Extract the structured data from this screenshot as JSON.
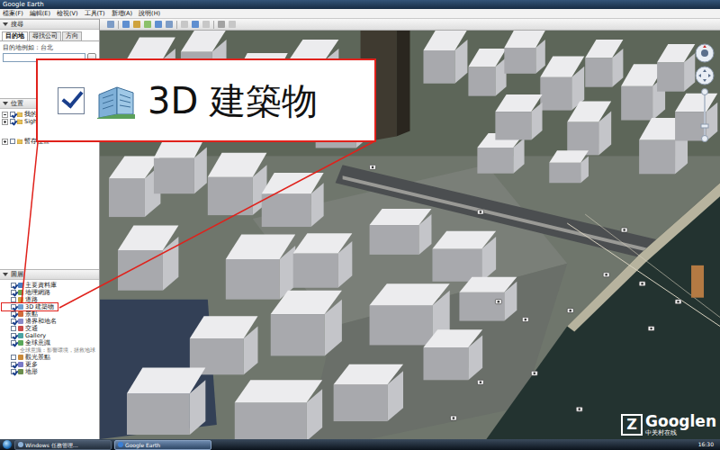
{
  "window": {
    "title": "Google Earth"
  },
  "menu": [
    "檔案(F)",
    "編輯(E)",
    "檢視(V)",
    "工具(T)",
    "新增(A)",
    "說明(H)"
  ],
  "search": {
    "header": "搜尋",
    "tabs": [
      {
        "label": "目的地",
        "selected": true
      },
      {
        "label": "尋找公司",
        "selected": false
      },
      {
        "label": "方向",
        "selected": false
      }
    ],
    "hint": "目的地例如：台北"
  },
  "places": {
    "header": "位置",
    "items": [
      {
        "label": "我的位置",
        "checked": true,
        "expanded": true
      },
      {
        "label": "Sightseeing",
        "checked": true,
        "expanded": false
      },
      {
        "label": "暫存位置",
        "checked": false,
        "expanded": false
      }
    ]
  },
  "layers": {
    "header": "圖層",
    "items": [
      {
        "kind": "layer",
        "label": "主要資料庫",
        "checked": true,
        "highlighted": false
      },
      {
        "kind": "layer",
        "label": "地理網路",
        "checked": true,
        "highlighted": false
      },
      {
        "kind": "layer",
        "label": "道路",
        "checked": false,
        "highlighted": false
      },
      {
        "kind": "layer",
        "label": "3D 建築物",
        "checked": true,
        "highlighted": true
      },
      {
        "kind": "layer",
        "label": "景點",
        "checked": true,
        "highlighted": false
      },
      {
        "kind": "layer",
        "label": "邊界和地名",
        "checked": true,
        "highlighted": false
      },
      {
        "kind": "layer",
        "label": "交通",
        "checked": false,
        "highlighted": false
      },
      {
        "kind": "layer",
        "label": "Gallery",
        "checked": true,
        "highlighted": false
      },
      {
        "kind": "layer",
        "label": "全球意識",
        "checked": true,
        "highlighted": false
      },
      {
        "kind": "note",
        "label": "全球意識：影響環境，拯救地球"
      },
      {
        "kind": "layer",
        "label": "觀光景點",
        "checked": false,
        "highlighted": false
      },
      {
        "kind": "layer",
        "label": "更多",
        "checked": true,
        "highlighted": false
      },
      {
        "kind": "layer",
        "label": "地形",
        "checked": true,
        "highlighted": false
      }
    ]
  },
  "callout": {
    "label": "3D 建築物",
    "checked": true
  },
  "taskbar": {
    "items": [
      {
        "label": "Windows 任務管理…",
        "selected": false
      },
      {
        "label": "Google Earth",
        "selected": true
      }
    ],
    "time": "16:30"
  },
  "watermark": {
    "logo": "Z",
    "text": "Googlen",
    "sub": "中关村在线"
  }
}
